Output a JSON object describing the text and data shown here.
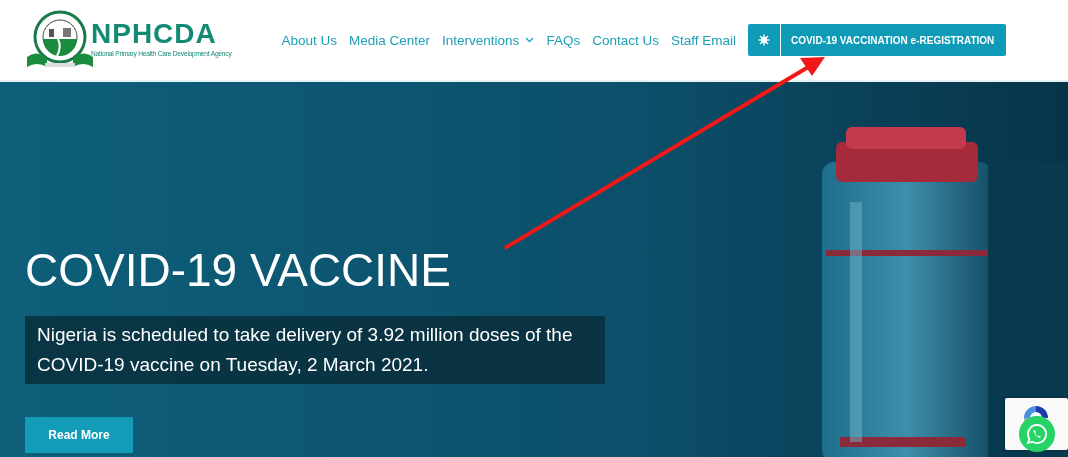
{
  "logo": {
    "name": "NPHCDA",
    "tagline": "National Primary Health Care Development Agency"
  },
  "nav": [
    {
      "label": "About Us",
      "kind": "link"
    },
    {
      "label": "Media Center",
      "kind": "link"
    },
    {
      "label": "Interventions",
      "kind": "dropdown"
    },
    {
      "label": "FAQs",
      "kind": "link"
    },
    {
      "label": "Contact Us",
      "kind": "link"
    },
    {
      "label": "Staff Email",
      "kind": "link"
    }
  ],
  "cta_button": {
    "label": "COVID-19 VACCINATION e-REGISTRATION"
  },
  "hero": {
    "title": "COVID-19 VACCINE",
    "caption": "Nigeria is scheduled to take delivery of 3.92 million doses of the COVID-19 vaccine on Tuesday, 2 March 2021.",
    "button": "Read More"
  }
}
